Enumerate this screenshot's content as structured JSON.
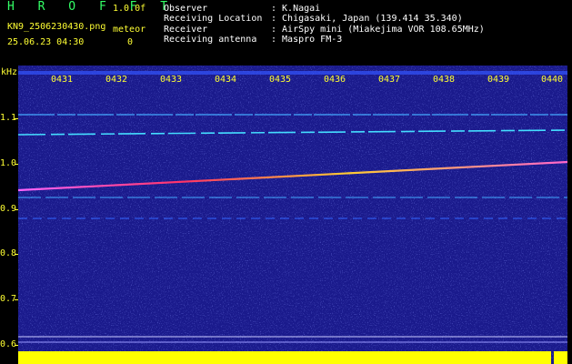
{
  "header": {
    "title": "H R O F F T",
    "version": "1.0.0f",
    "filename": "KN9_2506230430.png",
    "datetime": "25.06.23 04:30",
    "meteor_label": "meteor",
    "meteor_count": "0",
    "info": [
      {
        "label": "Observer",
        "value": ": K.Nagai"
      },
      {
        "label": "Receiving Location",
        "value": ": Chigasaki, Japan (139.414 35.340)"
      },
      {
        "label": "Receiver",
        "value": ": AirSpy mini (Miakejima VOR 108.65MHz)"
      },
      {
        "label": "Receiving antenna",
        "value": ": Maspro FM-3"
      }
    ]
  },
  "axis": {
    "unit": "kHz",
    "y_labels": [
      "1.1",
      "1.0",
      "0.9",
      "0.8",
      "0.7",
      "0.6"
    ],
    "time_labels": [
      "0431",
      "0432",
      "0433",
      "0434",
      "0435",
      "0436",
      "0437",
      "0438",
      "0439",
      "0440"
    ]
  },
  "colors": {
    "background": "#1a1a8c",
    "label": "#ffff33",
    "level_bar": "#ffff00"
  }
}
